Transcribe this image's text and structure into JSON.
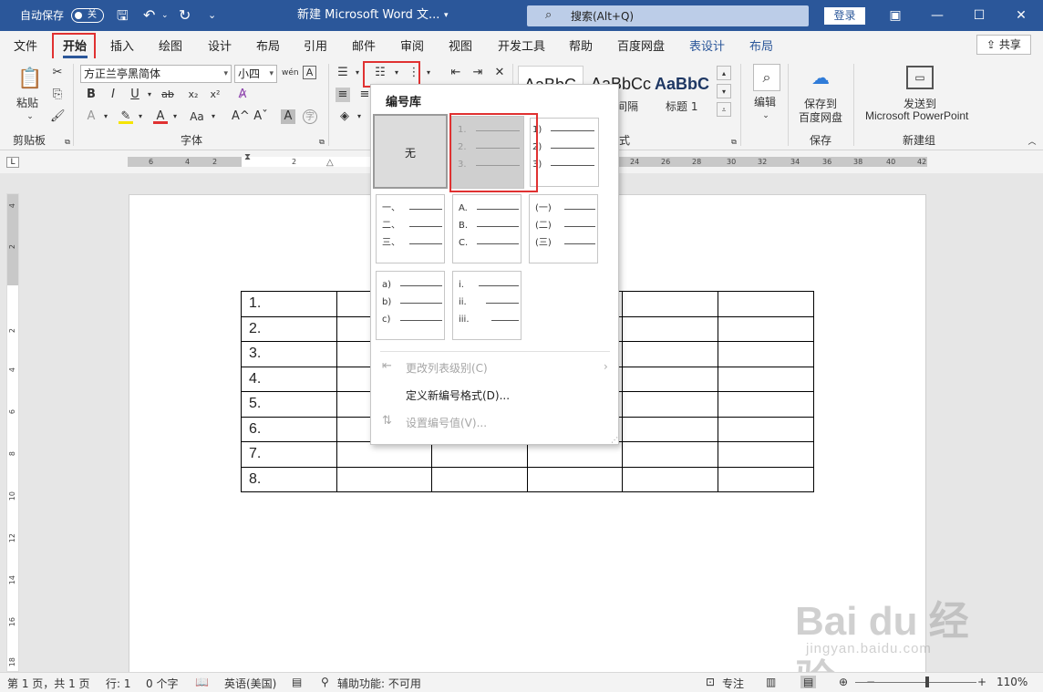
{
  "titlebar": {
    "autosave_label": "自动保存",
    "autosave_state": "关",
    "doc_title": "新建 Microsoft Word 文...",
    "search_text": "搜索(Alt+Q)",
    "login_label": "登录",
    "bg_color": "#2b579a"
  },
  "tabs": [
    "文件",
    "开始",
    "插入",
    "绘图",
    "设计",
    "布局",
    "引用",
    "邮件",
    "审阅",
    "视图",
    "开发工具",
    "帮助",
    "百度网盘",
    "表设计",
    "布局"
  ],
  "share_label": "共享",
  "ribbon": {
    "paste_label": "粘贴",
    "clipboard_group": "剪贴板",
    "font_name": "方正兰亭黑简体",
    "font_size": "小四",
    "font_group": "字体",
    "paragraph_group_tail": "式",
    "style_samples": [
      "AaBbC",
      "AaBbCc",
      "AaBbC"
    ],
    "style_names": [
      "间隔",
      "标题 1"
    ],
    "edit_label": "编辑",
    "save_baidu_label_1": "保存到",
    "save_baidu_label_2": "百度网盘",
    "save_group": "保存",
    "send_label_1": "发送到",
    "send_label_2": "Microsoft PowerPoint",
    "new_group": "新建组",
    "font_glyphs": {
      "bold": "B",
      "italic": "I",
      "underline": "U",
      "strike": "ab",
      "sub": "x₂",
      "sup": "x²",
      "aa": "Aa",
      "grow": "A^",
      "shrink": "Aˇ",
      "char_a": "A"
    }
  },
  "ruler": {
    "h_numbers": [
      "6",
      "4",
      "2",
      "2",
      "24",
      "26",
      "28",
      "30",
      "32",
      "34",
      "36",
      "38",
      "40",
      "42"
    ],
    "v_numbers": [
      "4",
      "2",
      "2",
      "4",
      "6",
      "8",
      "10",
      "12",
      "14",
      "16",
      "18"
    ]
  },
  "numbering_dropdown": {
    "title": "编号库",
    "none_label": "无",
    "tile_123": [
      "1.",
      "2.",
      "3."
    ],
    "tile_paren": [
      "1)",
      "2)",
      "3)"
    ],
    "tile_cn": [
      "一、",
      "二、",
      "三、"
    ],
    "tile_abc": [
      "A.",
      "B.",
      "C."
    ],
    "tile_cnparen": [
      "(一)",
      "(二)",
      "(三)"
    ],
    "tile_lower": [
      "a)",
      "b)",
      "c)"
    ],
    "tile_roman": [
      "i.",
      "ii.",
      "iii."
    ],
    "menu": {
      "change_level": "更改列表级别(C)",
      "define_new": "定义新编号格式(D)...",
      "set_value": "设置编号值(V)..."
    }
  },
  "table": {
    "col1": [
      "1.",
      "2.",
      "3.",
      "4.",
      "5.",
      "6.",
      "7.",
      "8."
    ]
  },
  "statusbar": {
    "page": "第 1 页，共 1 页",
    "line": "行: 1",
    "words": "0 个字",
    "language": "英语(美国)",
    "accessibility": "辅助功能: 不可用",
    "focus": "专注",
    "zoom": "110%"
  },
  "watermark": {
    "brand": "Bai du 经验",
    "url": "jingyan.baidu.com"
  },
  "highlight_color": "#e03131"
}
